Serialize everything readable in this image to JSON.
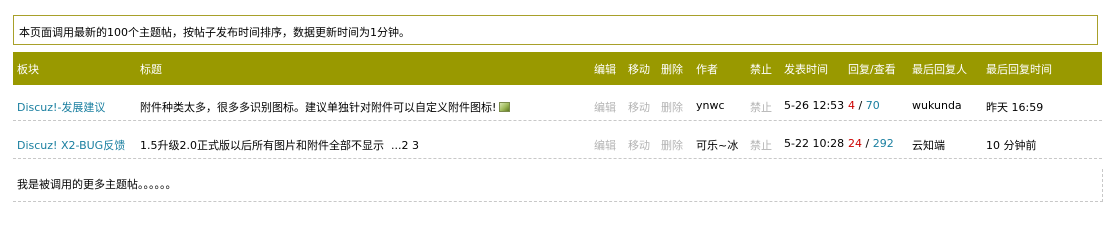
{
  "notice": "本页面调用最新的100个主题帖，按帖子发布时间排序，数据更新时间为1分钟。",
  "columns": {
    "forum": "板块",
    "title": "标题",
    "edit": "编辑",
    "move": "移动",
    "delete": "删除",
    "author": "作者",
    "ban": "禁止",
    "posted": "发表时间",
    "replies_views": "回复/查看",
    "last_replier": "最后回复人",
    "last_reply_time": "最后回复时间"
  },
  "rows": [
    {
      "forum": "Discuz!-发展建议",
      "title": "附件种类太多，很多多识别图标。建议单独针对附件可以自定义附件图标!",
      "has_attachment": true,
      "pages": "",
      "edit": "编辑",
      "move": "移动",
      "delete": "删除",
      "author": "ynwc",
      "ban": "禁止",
      "posted": "5-26 12:53",
      "replies": "4",
      "views": "70",
      "last_replier": "wukunda",
      "last_reply_time": "昨天  16:59"
    },
    {
      "forum": "Discuz! X2-BUG反馈",
      "title": "1.5升级2.0正式版以后所有图片和附件全部不显示",
      "has_attachment": false,
      "pages": "...2 3",
      "edit": "编辑",
      "move": "移动",
      "delete": "删除",
      "author": "可乐~冰",
      "ban": "禁止",
      "posted": "5-22 10:28",
      "replies": "24",
      "views": "292",
      "last_replier": "云知端",
      "last_reply_time": "10 分钟前"
    }
  ],
  "footer": "我是被调用的更多主题帖。。。。。。",
  "colors": {
    "header_bg": "#999900",
    "link": "#1a7fa0",
    "replies": "#cc0000",
    "disabled": "#b4b4b4"
  },
  "icons": {
    "attachment": "image-attachment-icon"
  }
}
